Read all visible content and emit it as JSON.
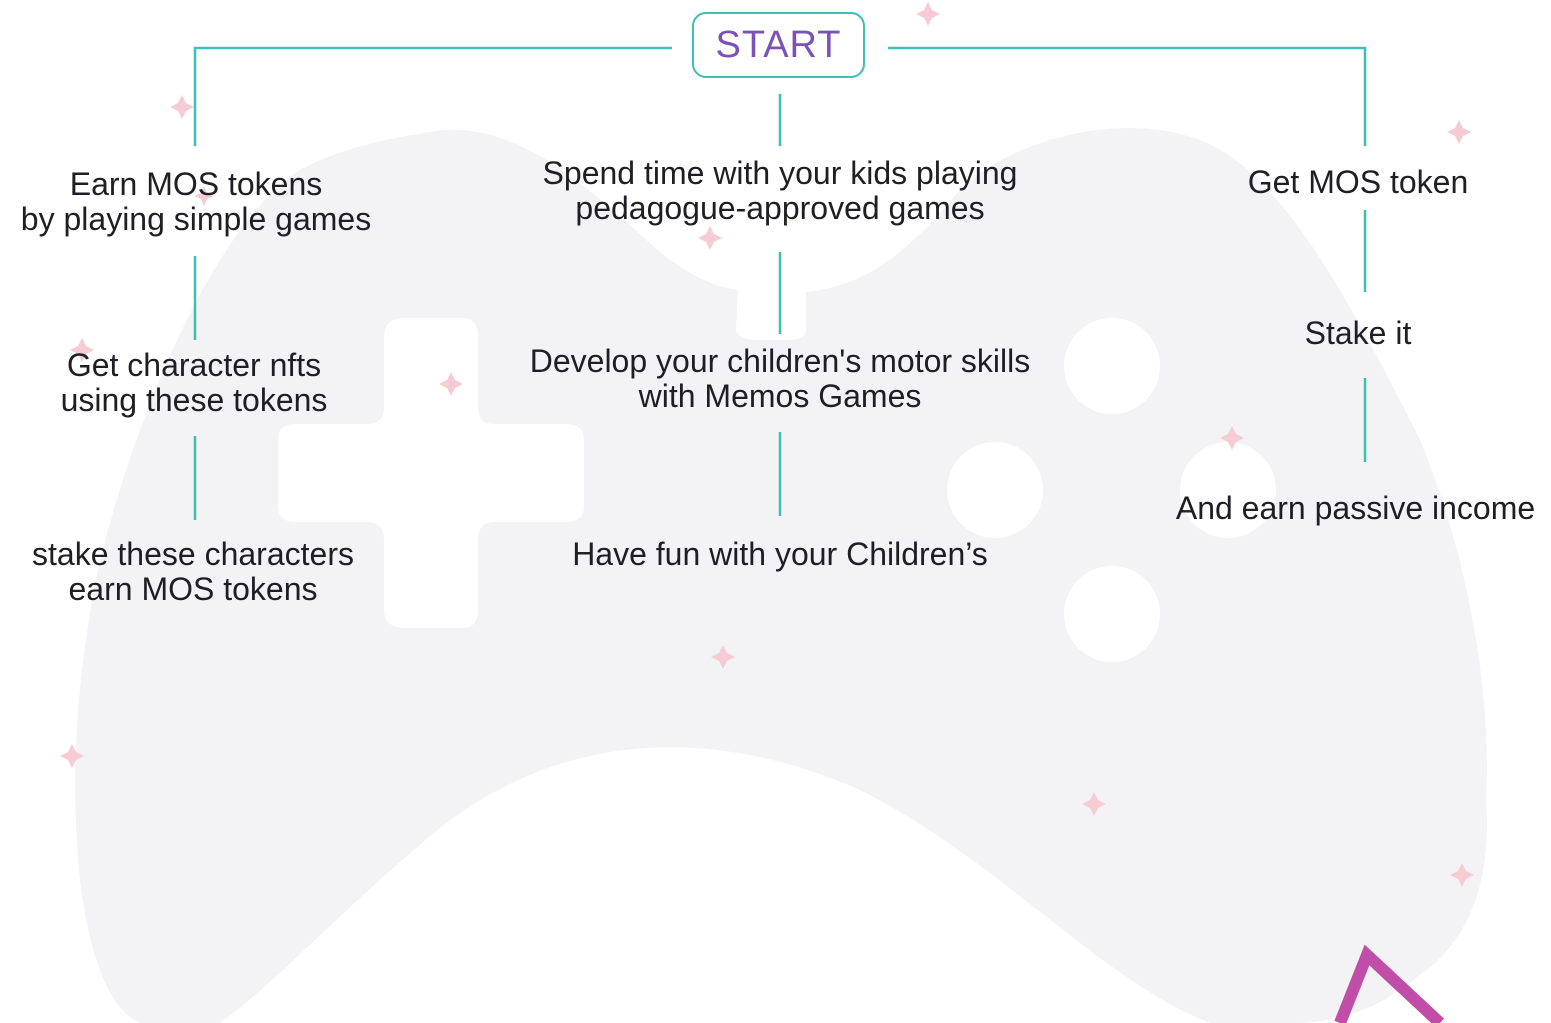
{
  "start": {
    "label": "START"
  },
  "columns": [
    {
      "id": "left",
      "steps": [
        {
          "lines": [
            "Earn MOS tokens",
            "by playing simple games"
          ]
        },
        {
          "lines": [
            "Get character nfts",
            "using these tokens"
          ]
        },
        {
          "lines": [
            "stake these characters",
            "earn MOS tokens"
          ]
        }
      ]
    },
    {
      "id": "center",
      "steps": [
        {
          "lines": [
            "Spend time with your kids playing",
            "pedagogue-approved games"
          ]
        },
        {
          "lines": [
            "Develop your children's motor skills",
            "with Memos Games"
          ]
        },
        {
          "lines": [
            "Have fun with your Children’s"
          ]
        }
      ]
    },
    {
      "id": "right",
      "steps": [
        {
          "lines": [
            "Get MOS token"
          ]
        },
        {
          "lines": [
            "Stake it"
          ]
        },
        {
          "lines": [
            "And earn passive income"
          ]
        }
      ]
    }
  ],
  "colors": {
    "connector": "#3fbfb3",
    "start_text": "#7a52b8",
    "controller_fill": "#f3f3f5",
    "sparkle": "#f7cbd4",
    "accent_triangle": "#c04ea8"
  },
  "decorations": {
    "background": "game-controller-silhouette",
    "sparkles": "sparkle-icon",
    "corner_shape": "triangle-outline"
  }
}
